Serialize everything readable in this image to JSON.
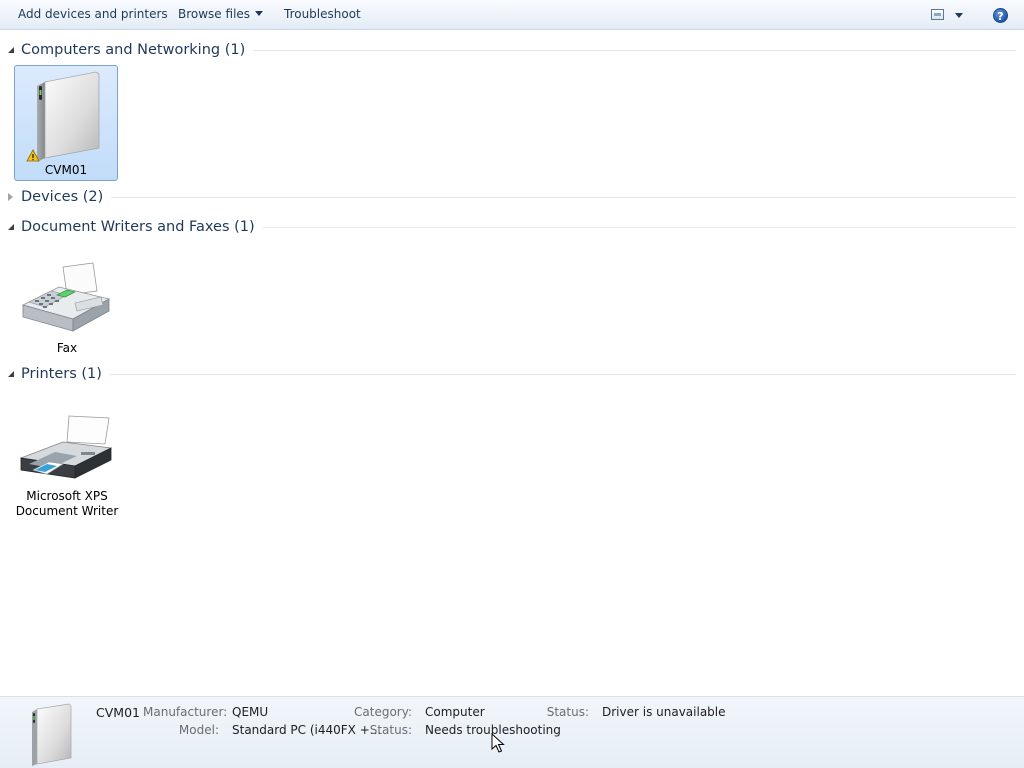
{
  "toolbar": {
    "add_devices": "Add devices and printers",
    "browse_files": "Browse files",
    "troubleshoot": "Troubleshoot",
    "help_glyph": "?"
  },
  "groups": [
    {
      "title": "Computers and Networking (1)",
      "expanded": true
    },
    {
      "title": "Devices (2)",
      "expanded": false
    },
    {
      "title": "Document Writers and Faxes (1)",
      "expanded": true
    },
    {
      "title": "Printers (1)",
      "expanded": true
    }
  ],
  "tiles": {
    "computer": {
      "label": "CVM01",
      "icon": "computer-tower-icon",
      "badge": "warning-icon"
    },
    "fax": {
      "label": "Fax",
      "icon": "fax-machine-icon"
    },
    "printer": {
      "label_line1": "Microsoft XPS",
      "label_line2": "Document Writer",
      "icon": "printer-icon"
    }
  },
  "details": {
    "name": "CVM01",
    "manufacturer_label": "Manufacturer:",
    "manufacturer": "QEMU",
    "model_label": "Model:",
    "model": "Standard PC (i440FX +...",
    "category_label": "Category:",
    "category": "Computer",
    "status_label_1": "Status:",
    "status_1": "Needs troubleshooting",
    "status_label_2": "Status:",
    "status_2": "Driver is unavailable"
  },
  "colors": {
    "header_text": "#1e395b",
    "selection_fill": "#c1dcf9",
    "selection_border": "#7da2ce"
  }
}
